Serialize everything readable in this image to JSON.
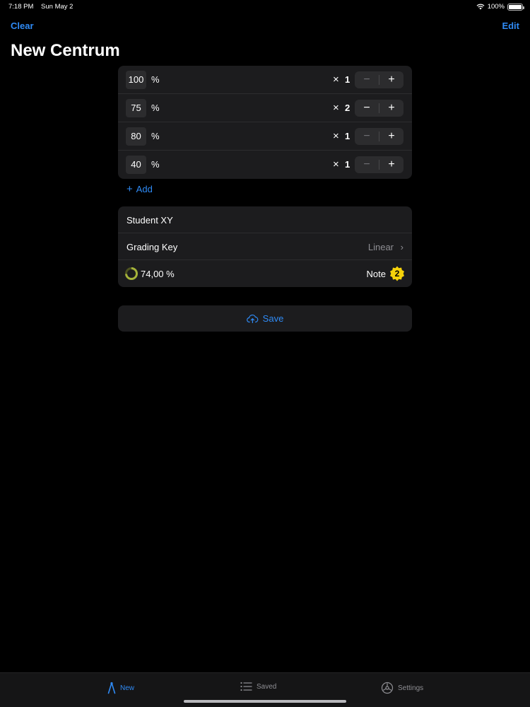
{
  "status_bar": {
    "time": "7:18 PM",
    "date": "Sun May 2",
    "battery": "100%"
  },
  "nav": {
    "left_button": "Clear",
    "right_button": "Edit",
    "title": "New Centrum"
  },
  "scores": [
    {
      "value": "100",
      "unit": "%",
      "times": "×",
      "multiplier": "1",
      "minus_enabled": false
    },
    {
      "value": "75",
      "unit": "%",
      "times": "×",
      "multiplier": "2",
      "minus_enabled": true
    },
    {
      "value": "80",
      "unit": "%",
      "times": "×",
      "multiplier": "1",
      "minus_enabled": false
    },
    {
      "value": "40",
      "unit": "%",
      "times": "×",
      "multiplier": "1",
      "minus_enabled": false
    }
  ],
  "stepper": {
    "minus": "−",
    "plus": "+"
  },
  "add_button": {
    "icon": "+",
    "label": "Add"
  },
  "info": {
    "student_name": "Student XY",
    "grading_key_label": "Grading Key",
    "grading_key_value": "Linear",
    "chevron": "›",
    "average": "74,00 %",
    "average_fraction": 0.74,
    "note_label": "Note",
    "note_value": "2"
  },
  "save_button": {
    "label": "Save",
    "icon": "cloud-upload-icon"
  },
  "tabs": [
    {
      "label": "New",
      "icon": "compass-icon",
      "active": true
    },
    {
      "label": "Saved",
      "icon": "list-icon",
      "active": false
    },
    {
      "label": "Settings",
      "icon": "gear-icon",
      "active": false
    }
  ],
  "colors": {
    "accent": "#2f8bf6",
    "card": "#1c1c1e",
    "ring": "#a5b33a",
    "badge": "#f5d20a"
  }
}
